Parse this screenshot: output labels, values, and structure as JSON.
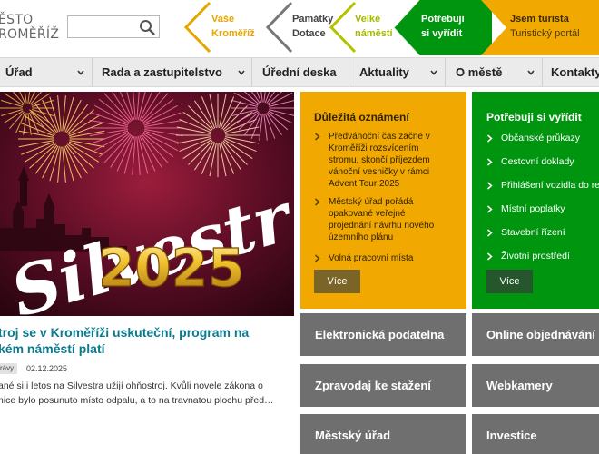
{
  "logo": {
    "line1": "ĚSTO",
    "line2": "ROMĚŘÍŽ"
  },
  "search": {
    "value": "",
    "placeholder": ""
  },
  "header_links": [
    {
      "line1": "Vaše",
      "line2": "Kroměříž"
    },
    {
      "line1": "Památky",
      "line2": "Dotace"
    },
    {
      "line1": "Velké",
      "line2": "náměstí"
    },
    {
      "line1": "Potřebuji",
      "line2": "si vyřídit"
    },
    {
      "line1": "Jsem turista",
      "line2": "Turistický portál"
    }
  ],
  "nav": [
    {
      "label": "Úřad"
    },
    {
      "label": "Rada a zastupitelstvo"
    },
    {
      "label": "Úřední deska"
    },
    {
      "label": "Aktuality"
    },
    {
      "label": "O městě"
    },
    {
      "label": "Kontakty"
    }
  ],
  "hero": {
    "text_main": "Silvestr",
    "text_year": "2025"
  },
  "article": {
    "title_line1": "troj se v Kroměříži uskuteční, program na",
    "title_line2": "kém náměstí platí",
    "tag": "rávy",
    "date": "02.12.2025",
    "excerpt_line1": "ané si i letos na Silvestra užijí ohňostroj. Kvůli novele zákona o",
    "excerpt_line2": "nice bylo posunuto místo odpalu, a to na travnatou plochu před…"
  },
  "important": {
    "title": "Důležitá oznámení",
    "items": [
      {
        "l1": "Předvánoční čas začne v",
        "l2": "Kroměříži rozsvícením",
        "l3": "stromu, skončí příjezdem",
        "l4": "vánoční vesničky v rámci",
        "l5": "Advent Tour 2025"
      },
      {
        "l1": "Městský úřad pořádá",
        "l2": "opakované veřejné",
        "l3": "projednání návrhu nového",
        "l4": "územního plánu"
      },
      {
        "l1": "Volná pracovní místa"
      }
    ],
    "more": "Více"
  },
  "tasks": {
    "title": "Potřebuji si vyřídit",
    "items": [
      {
        "label": "Občanské průkazy"
      },
      {
        "label": "Cestovní doklady"
      },
      {
        "label": "Přihlášení vozidla do reg"
      },
      {
        "label": "Místní poplatky"
      },
      {
        "label": "Stavební řízení"
      },
      {
        "label": "Životní prostředí"
      }
    ],
    "more": "Více"
  },
  "tiles": [
    {
      "label": "Elektronická podatelna"
    },
    {
      "label": "Online objednávání"
    },
    {
      "label": "Zpravodaj ke stažení"
    },
    {
      "label": "Webkamery"
    },
    {
      "label": "Městský úřad"
    },
    {
      "label": "Investice"
    }
  ],
  "colors": {
    "orange": "#f1a800",
    "green": "#00950f",
    "tile_gray": "#6f6f6f",
    "teal_title": "#0a7a8f"
  }
}
